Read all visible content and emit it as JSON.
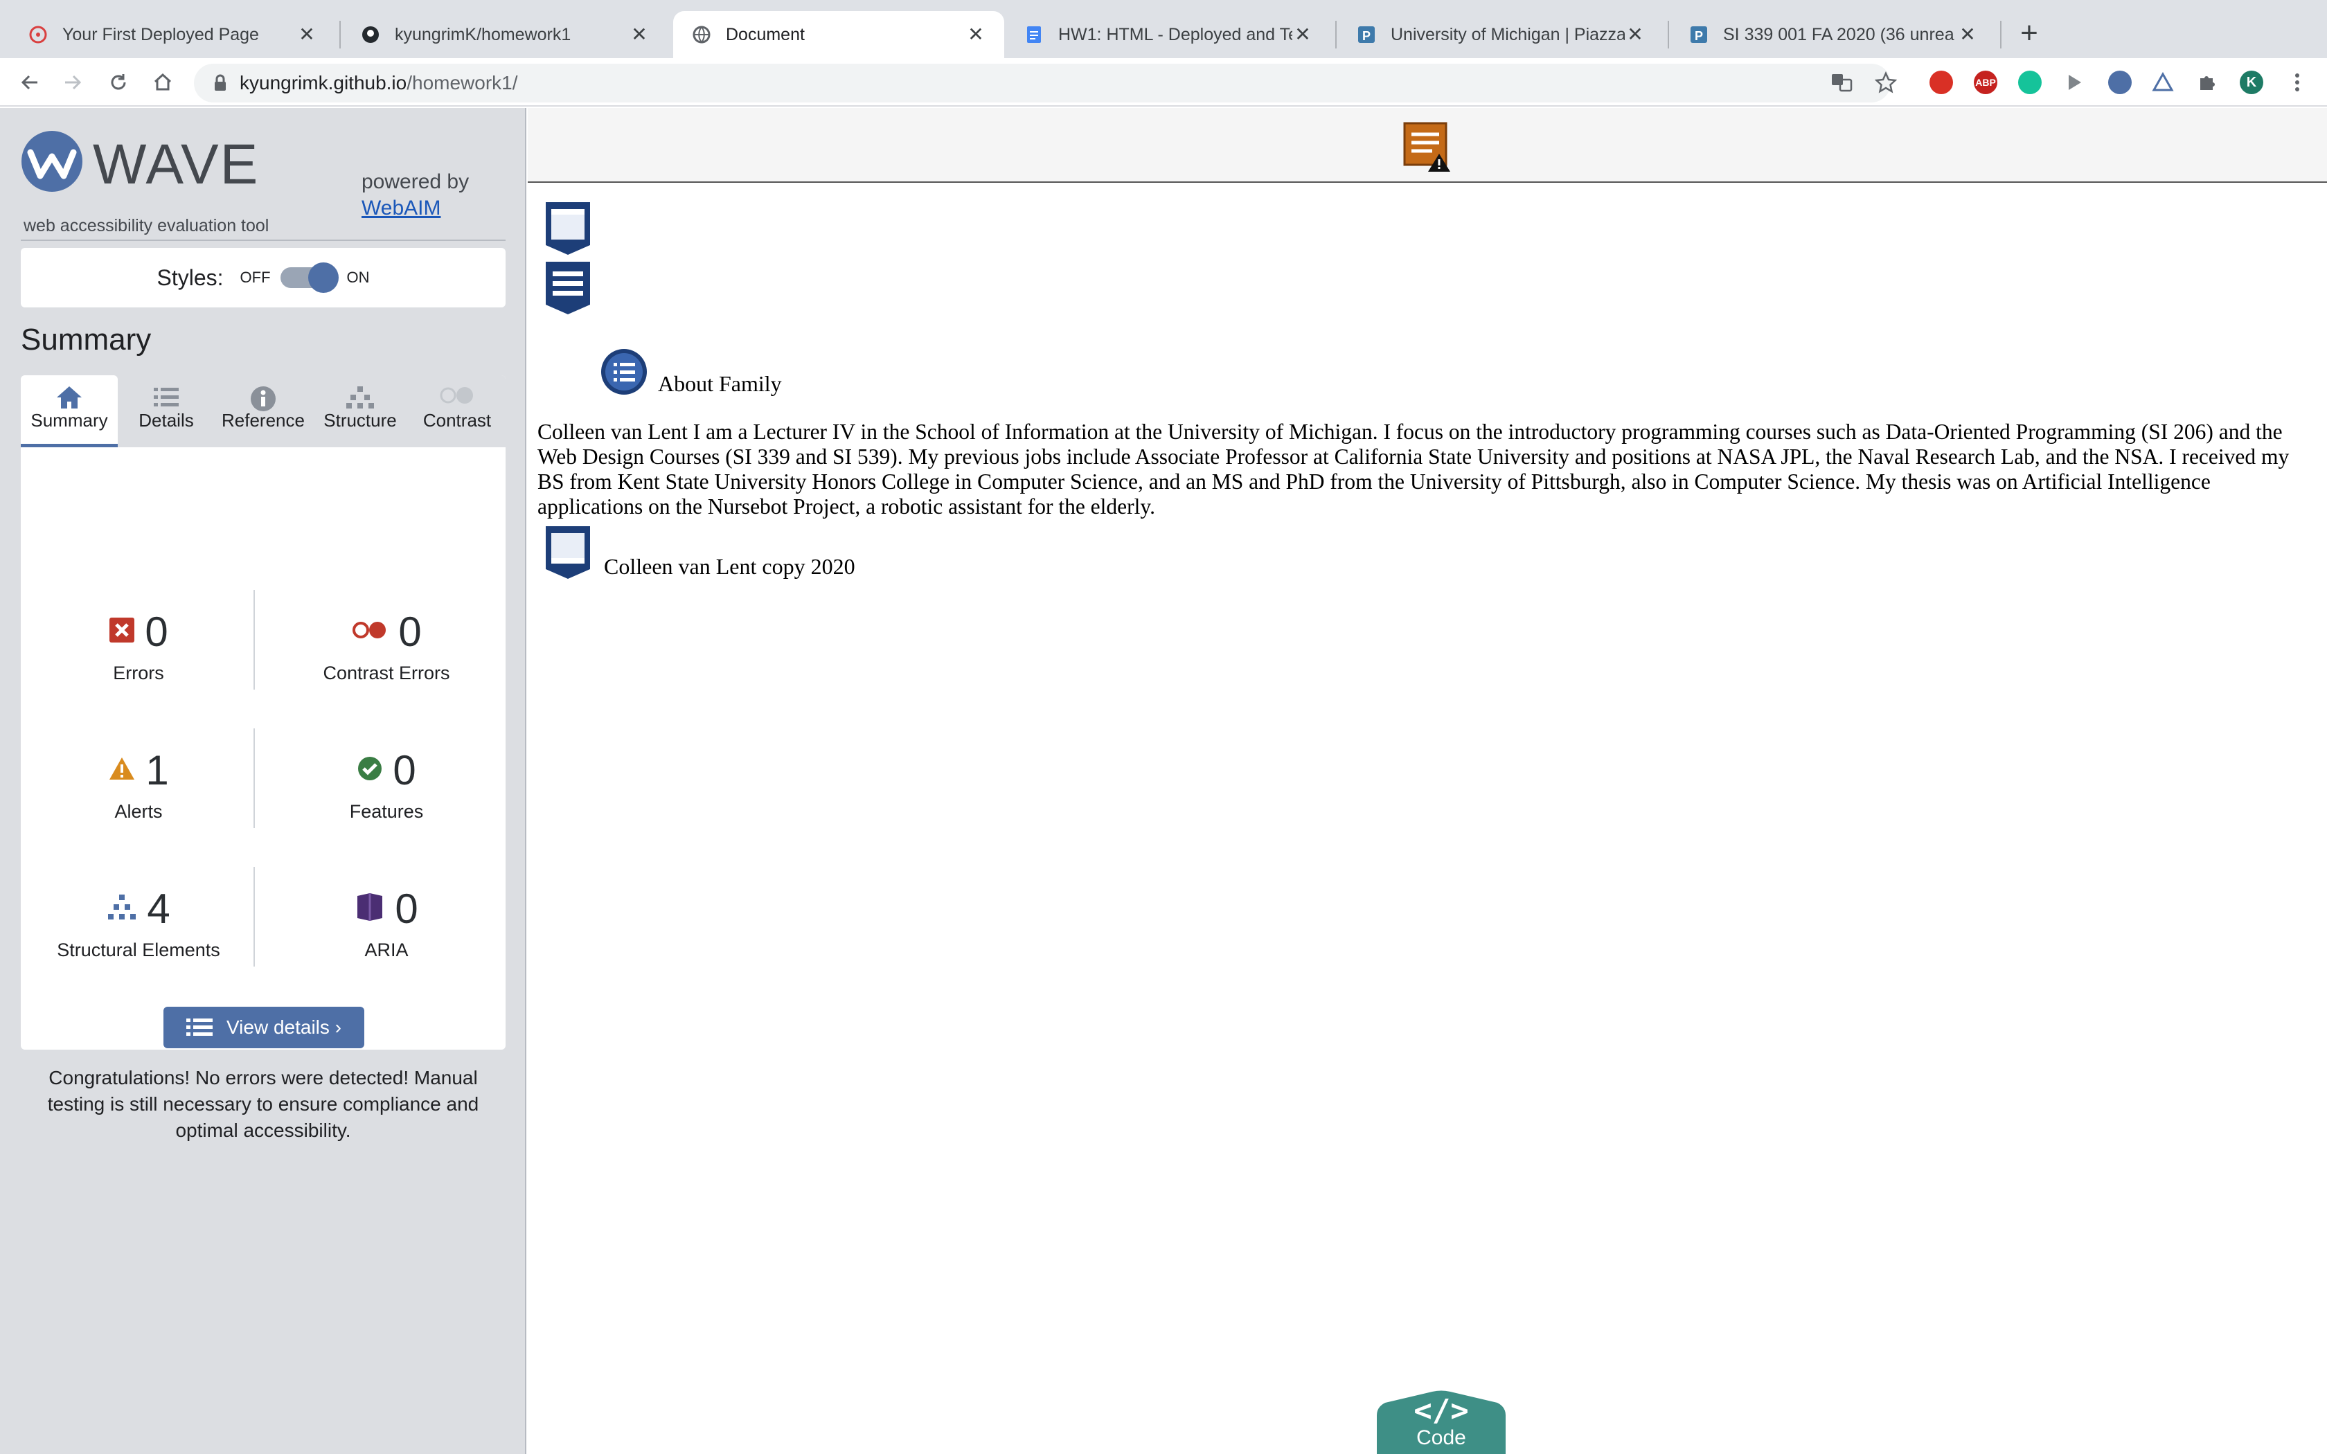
{
  "browser": {
    "tabs": [
      {
        "title": "Your First Deployed Page",
        "active": false
      },
      {
        "title": "kyungrimK/homework1",
        "active": false
      },
      {
        "title": "Document",
        "active": true
      },
      {
        "title": "HW1: HTML - Deployed and Te",
        "active": false
      },
      {
        "title": "University of Michigan | Piazza",
        "active": false
      },
      {
        "title": "SI 339 001 FA 2020 (36 unrea",
        "active": false
      }
    ],
    "new_tab": "+",
    "close_glyph": "✕",
    "url_host": "kyungrimk.github.io",
    "url_path": "/homework1/",
    "profile_initial": "K",
    "adblock_label": "ABP"
  },
  "wave": {
    "name": "WAVE",
    "tagline": "web accessibility evaluation tool",
    "powered_by": "powered by",
    "webaim_link": "WebAIM",
    "styles_label": "Styles:",
    "styles_off": "OFF",
    "styles_on": "ON",
    "styles_enabled": true,
    "summary_heading": "Summary",
    "tabs": [
      "Summary",
      "Details",
      "Reference",
      "Structure",
      "Contrast"
    ],
    "active_tab": "Summary",
    "stats": {
      "errors": {
        "value": "0",
        "label": "Errors"
      },
      "contrast_errors": {
        "value": "0",
        "label": "Contrast Errors"
      },
      "alerts": {
        "value": "1",
        "label": "Alerts"
      },
      "features": {
        "value": "0",
        "label": "Features"
      },
      "structural": {
        "value": "4",
        "label": "Structural Elements"
      },
      "aria": {
        "value": "0",
        "label": "ARIA"
      }
    },
    "view_details": "View details ›",
    "congrats": "Congratulations! No errors were detected! Manual testing is still necessary to ensure compliance and optimal accessibility."
  },
  "page": {
    "about_heading": "About Family",
    "bio": "Colleen van Lent I am a Lecturer IV in the School of Information at the University of Michigan. I focus on the introductory programming courses such as Data-Oriented Programming (SI 206) and the Web Design Courses (SI 339 and SI 539). My previous jobs include Associate Professor at California State University and positions at NASA JPL, the Naval Research Lab, and the NSA. I received my BS from Kent State University Honors College in Computer Science, and an MS and PhD from the University of Pittsburgh, also in Computer Science. My thesis was on Artificial Intelligence applications on the Nursebot Project, a robotic assistant for the elderly.",
    "footer": "Colleen van Lent copy 2020",
    "code_glyph": "</>",
    "code_label": "Code"
  },
  "colors": {
    "wave_blue": "#4e6fa6",
    "error_red": "#c0392b",
    "alert_orange": "#d98b1e",
    "feature_green": "#3a7d44",
    "aria_purple": "#4b2e73",
    "code_teal": "#3e8f86"
  }
}
